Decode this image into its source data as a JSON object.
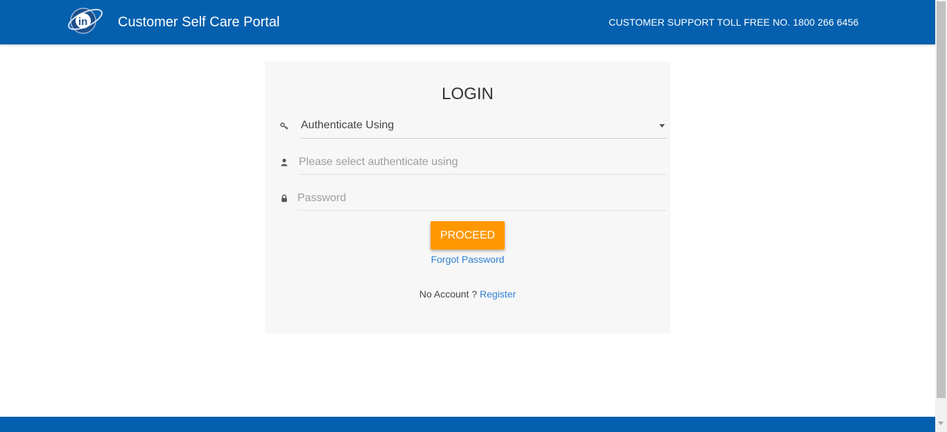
{
  "header": {
    "title": "Customer Self Care Portal",
    "support": "CUSTOMER SUPPORT TOLL FREE NO. 1800 266 6456",
    "logo_icon": "in-digital-logo"
  },
  "login": {
    "title": "LOGIN",
    "authenticate_select": {
      "label": "Authenticate Using",
      "icon": "key-icon"
    },
    "user_field": {
      "placeholder": "Please select authenticate using",
      "value": "",
      "icon": "user-icon"
    },
    "password_field": {
      "placeholder": "Password",
      "value": "",
      "icon": "lock-icon"
    },
    "proceed_label": "PROCEED",
    "forgot_label": "Forgot Password",
    "no_account_text": "No Account ?",
    "register_label": "Register"
  },
  "colors": {
    "brand_blue": "#0460ae",
    "accent_orange": "#ff9800",
    "link_blue": "#2f80d1"
  }
}
